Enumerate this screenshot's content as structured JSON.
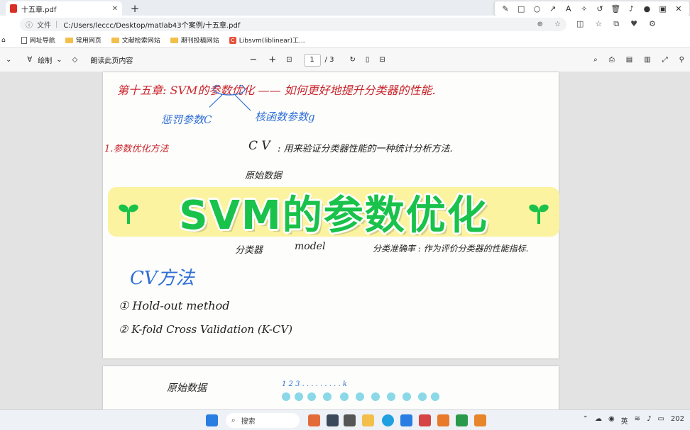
{
  "browser": {
    "tab_title": "十五章.pdf",
    "tab_close": "✕",
    "new_tab": "+",
    "address_label": "文件",
    "address_sep": "|",
    "url": "C:/Users/leccc/Desktop/matlab43个案例/十五章.pdf"
  },
  "bookmarks": [
    {
      "label": "网址导航",
      "icon": "page"
    },
    {
      "label": "常用网页",
      "icon": "folder"
    },
    {
      "label": "文献检索网站",
      "icon": "folder"
    },
    {
      "label": "期刊投稿网站",
      "icon": "folder"
    },
    {
      "label": "Libsvm(liblinear)工...",
      "icon": "c-icon"
    }
  ],
  "pdf_toolbar": {
    "draw_label": "绘制",
    "read_aloud_label": "朗读此页内容",
    "zoom_out": "−",
    "zoom_in": "+",
    "current_page": "1",
    "total_pages": "/ 3"
  },
  "handwriting": {
    "line1": "第十五章:  SVM的参数优化 —— 如何更好地提升分类器的性能.",
    "penalty": "惩罚参数C",
    "kernel": "核函数参数g",
    "side_note": "1.参数优化方法",
    "cv_mark": "C V",
    "cv_desc": ": 用来验证分类器性能的一种统计分析方法.",
    "raw_data": "原始数据",
    "classifier": "分类器",
    "model": "model",
    "accuracy": "分类准确率 : 作为评价分类器的性能指标.",
    "cv_method": "CV方法",
    "method1": "① Hold-out method",
    "method2": "② K-fold Cross Validation (K-CV)",
    "page2_raw": "原始数据",
    "page2_k": "1  2  3  .  .  .  .  .  .  .  .  .  k"
  },
  "banner": {
    "title": "SVM的参数优化"
  },
  "taskbar": {
    "search_placeholder": "搜索",
    "lang": "英",
    "clock": "202"
  },
  "colors": {
    "banner_bg": "#fbf3a0",
    "banner_text": "#19c24a",
    "ink_red": "#c8242b",
    "ink_blue": "#2e6fd6",
    "ink_black": "#222222"
  }
}
